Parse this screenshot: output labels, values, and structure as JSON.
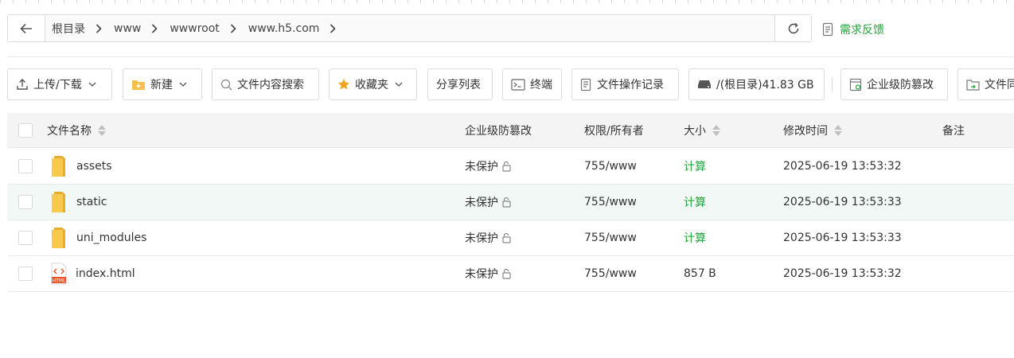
{
  "breadcrumb": [
    "根目录",
    "www",
    "wwwroot",
    "www.h5.com"
  ],
  "feedback_label": "需求反馈",
  "toolbar": {
    "upload": "上传/下载",
    "new": "新建",
    "search": "文件内容搜索",
    "favorites": "收藏夹",
    "share": "分享列表",
    "terminal": "终端",
    "oplog": "文件操作记录",
    "disk": "/(根目录)41.83 GB",
    "tamper": "企业级防篡改",
    "file_sync": "文件同"
  },
  "table": {
    "headers": {
      "name": "文件名称",
      "tamper": "企业级防篡改",
      "perm": "权限/所有者",
      "size": "大小",
      "mtime": "修改时间",
      "note": "备注"
    },
    "rows": [
      {
        "type": "folder",
        "name": "assets",
        "tamper": "未保护",
        "perm": "755/www",
        "size": "计算",
        "mtime": "2025-06-19 13:53:32",
        "note": ""
      },
      {
        "type": "folder",
        "name": "static",
        "tamper": "未保护",
        "perm": "755/www",
        "size": "计算",
        "mtime": "2025-06-19 13:53:33",
        "note": ""
      },
      {
        "type": "folder",
        "name": "uni_modules",
        "tamper": "未保护",
        "perm": "755/www",
        "size": "计算",
        "mtime": "2025-06-19 13:53:33",
        "note": ""
      },
      {
        "type": "html",
        "name": "index.html",
        "tamper": "未保护",
        "perm": "755/www",
        "size": "857 B",
        "mtime": "2025-06-19 13:53:32",
        "note": ""
      }
    ]
  },
  "icons": {
    "back": "arrow-left-icon",
    "refresh": "refresh-icon",
    "folder": "folder-icon",
    "html_file": "html-file-icon",
    "lock": "unlock-icon"
  },
  "colors": {
    "accent": "#20a53a",
    "folder": "#f5c04a",
    "highlight_row": "#f2f8f6"
  }
}
